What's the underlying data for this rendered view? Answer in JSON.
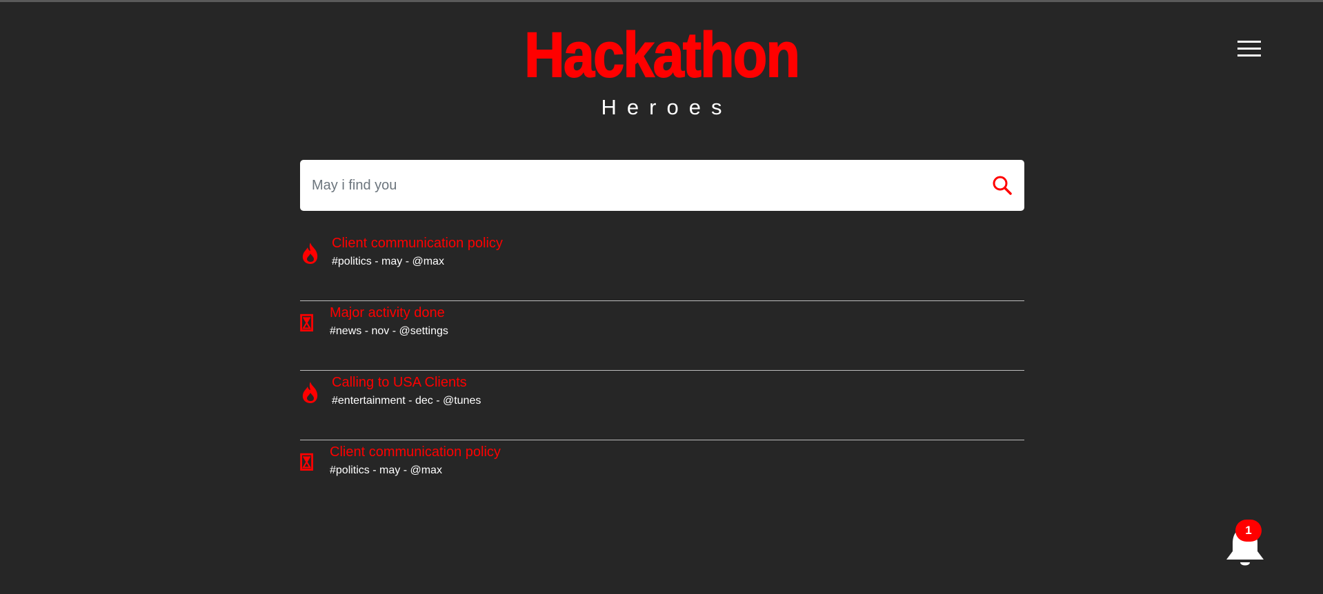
{
  "brand": {
    "title": "Hackathon",
    "subtitle": "Heroes"
  },
  "search": {
    "placeholder": "May i find you",
    "value": ""
  },
  "feed": [
    {
      "icon": "fire-icon",
      "title": "Client communication policy",
      "meta": "#politics - may - @max"
    },
    {
      "icon": "hourglass-icon",
      "title": "Major activity done",
      "meta": "#news - nov - @settings"
    },
    {
      "icon": "fire-icon",
      "title": "Calling to USA Clients",
      "meta": "#entertainment - dec - @tunes"
    },
    {
      "icon": "hourglass-icon",
      "title": "Client communication policy",
      "meta": "#politics - may - @max"
    }
  ],
  "notifications": {
    "count": "1",
    "icon": "bell-icon"
  },
  "colors": {
    "background": "#262626",
    "accent": "#ff0000",
    "text": "#ffffff",
    "divider": "#bdbdbd"
  }
}
